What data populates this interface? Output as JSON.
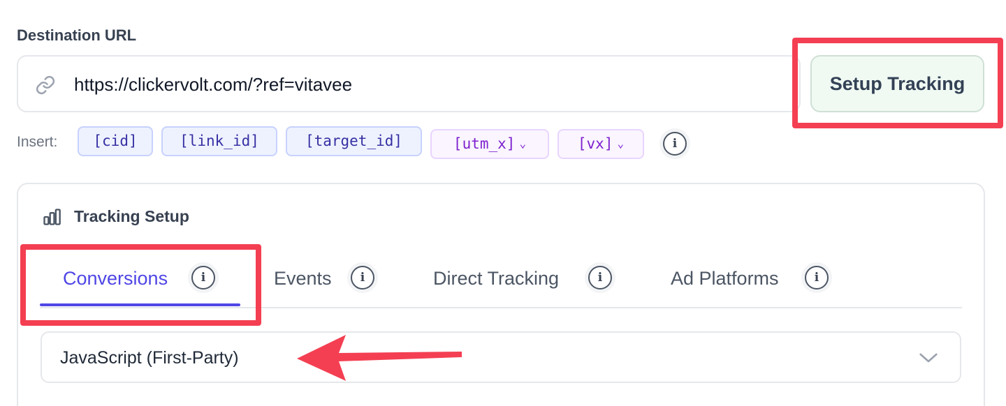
{
  "destination": {
    "label": "Destination URL",
    "url_value": "https://clickervolt.com/?ref=vitavee",
    "setup_button_label": "Setup Tracking"
  },
  "insert": {
    "label": "Insert:",
    "tokens": [
      "[cid]",
      "[link_id]",
      "[target_id]"
    ],
    "dropdown_tokens": [
      "[utm_x]",
      "[vx]"
    ],
    "info_glyph": "i"
  },
  "tracking": {
    "title": "Tracking Setup",
    "icon": "bar-chart-icon",
    "tabs": [
      {
        "label": "Conversions",
        "active": true
      },
      {
        "label": "Events",
        "active": false
      },
      {
        "label": "Direct Tracking",
        "active": false
      },
      {
        "label": "Ad Platforms",
        "active": false
      }
    ],
    "method_select": {
      "value": "JavaScript (First-Party)"
    }
  },
  "colors": {
    "accent": "#4f46e5",
    "annotation": "#f43f52",
    "setup_button_bg": "#f0faf3"
  }
}
